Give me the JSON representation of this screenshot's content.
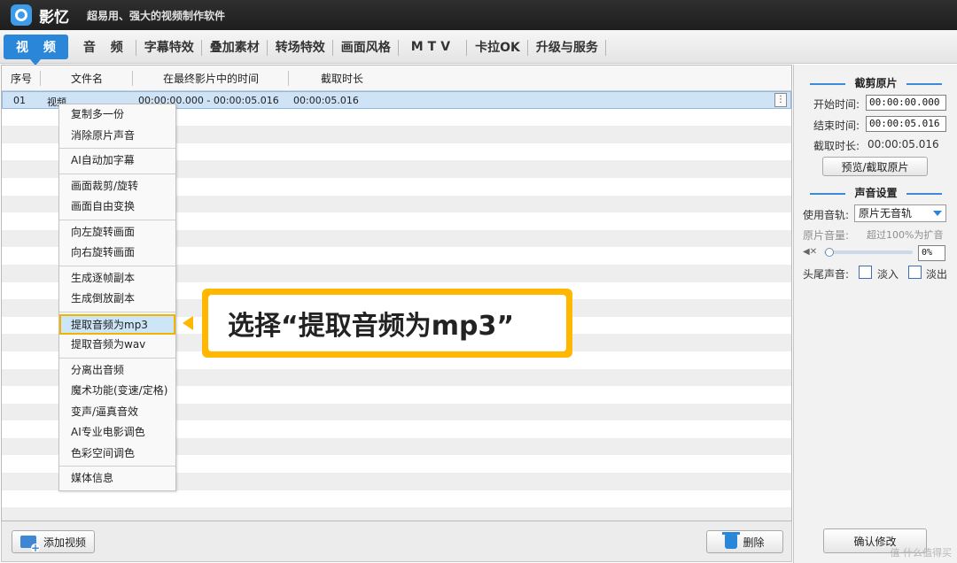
{
  "app": {
    "name": "影忆",
    "slogan": "超易用、强大的视频制作软件"
  },
  "tabs": [
    "视 频",
    "音 频",
    "字幕特效",
    "叠加素材",
    "转场特效",
    "画面风格",
    "MTV",
    "卡拉OK",
    "升级与服务"
  ],
  "list": {
    "headers": [
      "序号",
      "文件名",
      "在最终影片中的时间",
      "截取时长"
    ],
    "selected_row": {
      "index": "01",
      "filename": "视频",
      "time_range": "00:00:00.000 - 00:00:05.016",
      "duration": "00:00:05.016",
      "more_icon": "⋮"
    }
  },
  "context_menu": {
    "items": [
      "复制多一份",
      "消除原片声音",
      "AI自动加字幕",
      "画面裁剪/旋转",
      "画面自由变换",
      "向左旋转画面",
      "向右旋转画面",
      "生成逐帧副本",
      "生成倒放副本",
      "提取音频为mp3",
      "提取音频为wav",
      "分离出音频",
      "魔术功能(变速/定格)",
      "变声/逼真音效",
      "AI专业电影调色",
      "色彩空间调色",
      "媒体信息"
    ],
    "highlighted": "提取音频为mp3"
  },
  "callout": {
    "text": "选择“提取音频为mp3”"
  },
  "bottom": {
    "add_video": "添加视频",
    "delete": "删除"
  },
  "right_panel": {
    "crop_title": "截剪原片",
    "start_label": "开始时间:",
    "start_value": "00:00:00.000",
    "end_label": "结束时间:",
    "end_value": "00:00:05.016",
    "duration_label": "截取时长:",
    "duration_value": "00:00:05.016",
    "preview_button": "预览/截取原片",
    "sound_title": "声音设置",
    "track_label": "使用音轨:",
    "track_value": "原片无音轨",
    "volume_label": "原片音量:",
    "volume_hint": "超过100%为扩音",
    "volume_value": "0%",
    "fade_label": "头尾声音:",
    "fade_in": "淡入",
    "fade_out": "淡出",
    "ok_button": "确认修改"
  },
  "watermark": "值 什么值得买",
  "colors": {
    "accent": "#2a86d8",
    "callout": "#ffb700"
  }
}
